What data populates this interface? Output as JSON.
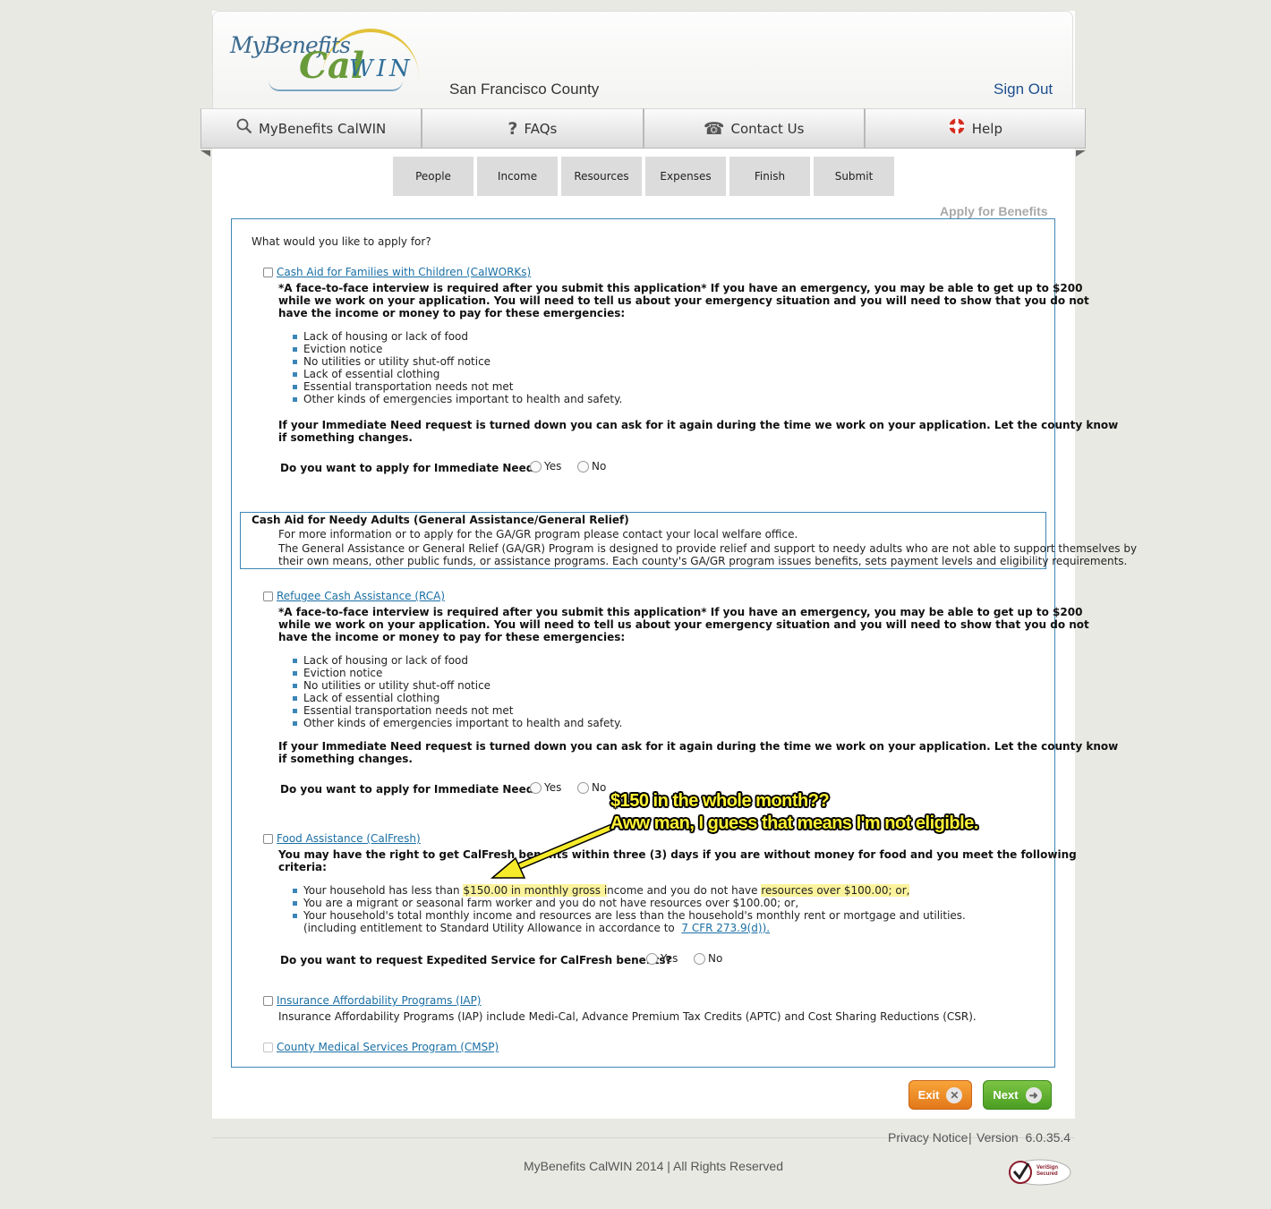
{
  "header": {
    "logo_my_benefits": "MyBenefits",
    "logo_cal": "Cal",
    "logo_win": "WIN",
    "county": "San Francisco County",
    "sign_out": "Sign Out"
  },
  "nav": {
    "tabs": [
      {
        "label": "MyBenefits CalWIN",
        "icon": "search-icon"
      },
      {
        "label": "FAQs",
        "icon": "question-icon"
      },
      {
        "label": "Contact Us",
        "icon": "phone-icon"
      },
      {
        "label": "Help",
        "icon": "lifebuoy-icon"
      }
    ]
  },
  "steps": [
    "People",
    "Income",
    "Resources",
    "Expenses",
    "Finish",
    "Submit"
  ],
  "apply_title": "Apply for Benefits",
  "form": {
    "question": "What would you like to apply for?",
    "calworks": {
      "link": "Cash Aid for Families with Children (CalWORKs)",
      "intro_lines": [
        "*A face-to-face interview is required after you submit this application* If you have an emergency, you may be able to get up to $200",
        "while we work on your application. You will need to tell us about your emergency situation and you will need to show that you do not",
        "have the income or money to pay for these emergencies:"
      ],
      "bullets": [
        "Lack of housing or lack of food",
        "Eviction notice",
        "No utilities or utility shut-off notice",
        "Lack of essential clothing",
        "Essential transportation needs not met",
        "Other kinds of emergencies important to health and safety."
      ],
      "note_lines": [
        "If your Immediate Need request is turned down you can ask for it again during the time we work on your application. Let the county know",
        "if something changes."
      ],
      "question": "Do you want to apply for Immediate Need?",
      "yes": "Yes",
      "no": "No"
    },
    "ga": {
      "title": "Cash Aid for Needy Adults (General Assistance/General Relief)",
      "lines": [
        "For more information or to apply for the GA/GR program please contact your local welfare office.",
        "The General Assistance or General Relief (GA/GR) Program is designed to provide relief and support to needy adults who are not able to support themselves by",
        "their own means, other public funds, or assistance programs. Each county's GA/GR program issues benefits, sets payment levels and eligibility requirements."
      ]
    },
    "rca": {
      "link": "Refugee Cash Assistance (RCA)",
      "intro_lines": [
        "*A face-to-face interview is required after you submit this application* If you have an emergency, you may be able to get up to $200",
        "while we work on your application. You will need to tell us about your emergency situation and you will need to show that you do not",
        "have the income or money to pay for these emergencies:"
      ],
      "bullets": [
        "Lack of housing or lack of food",
        "Eviction notice",
        "No utilities or utility shut-off notice",
        "Lack of essential clothing",
        "Essential transportation needs not met",
        "Other kinds of emergencies important to health and safety."
      ],
      "note_lines": [
        "If your Immediate Need request is turned down you can ask for it again during the time we work on your application. Let the county know",
        "if something changes."
      ],
      "question": "Do you want to apply for Immediate Need?",
      "yes": "Yes",
      "no": "No"
    },
    "calfresh": {
      "link": "Food Assistance (CalFresh)",
      "intro_lines": [
        "You may have the right to get CalFresh benefits within three (3) days if you are without money for food and you meet the following",
        "criteria:"
      ],
      "b1_a": "Your household has less than ",
      "b1_hl1": "$150.00 in monthly gross i",
      "b1_b": "ncome and you do not have ",
      "b1_hl2": "resources over $100.00; or,",
      "b2": "You are a migrant or seasonal farm worker and you do not have resources over $100.00; or,",
      "b3": "Your household's total monthly income and resources are less than the household's monthly rent or mortgage and utilities.",
      "b3_cont": "(including entitlement to Standard Utility Allowance in accordance to ",
      "b3_link": "7 CFR 273.9(d)).",
      "question": "Do you want to request Expedited Service for CalFresh benefits?",
      "yes": "Yes",
      "no": "No"
    },
    "iap": {
      "link": "Insurance Affordability Programs (IAP)",
      "desc": "Insurance Affordability Programs (IAP) include Medi-Cal, Advance Premium Tax Credits (APTC) and Cost Sharing Reductions (CSR)."
    },
    "cmsp": {
      "link": "County Medical Services Program (CMSP)"
    }
  },
  "annotation": {
    "line1": "$150 in the whole month??",
    "line2": "Aww man, I guess that means I'm not eligible."
  },
  "buttons": {
    "exit": "Exit",
    "next": "Next"
  },
  "footer": {
    "privacy": "Privacy Notice",
    "sep": "|",
    "version": "Version  6.0.35.4",
    "copyright": "MyBenefits CalWIN 2014 | All Rights Reserved",
    "verisign_1": "VeriSign",
    "verisign_2": "Secured"
  },
  "colors": {
    "accent_blue": "#3f87b3",
    "link_blue": "#1a6fa5",
    "highlight": "#fbf39c",
    "exit_orange": "#f08d2a",
    "next_green": "#5cb030"
  }
}
